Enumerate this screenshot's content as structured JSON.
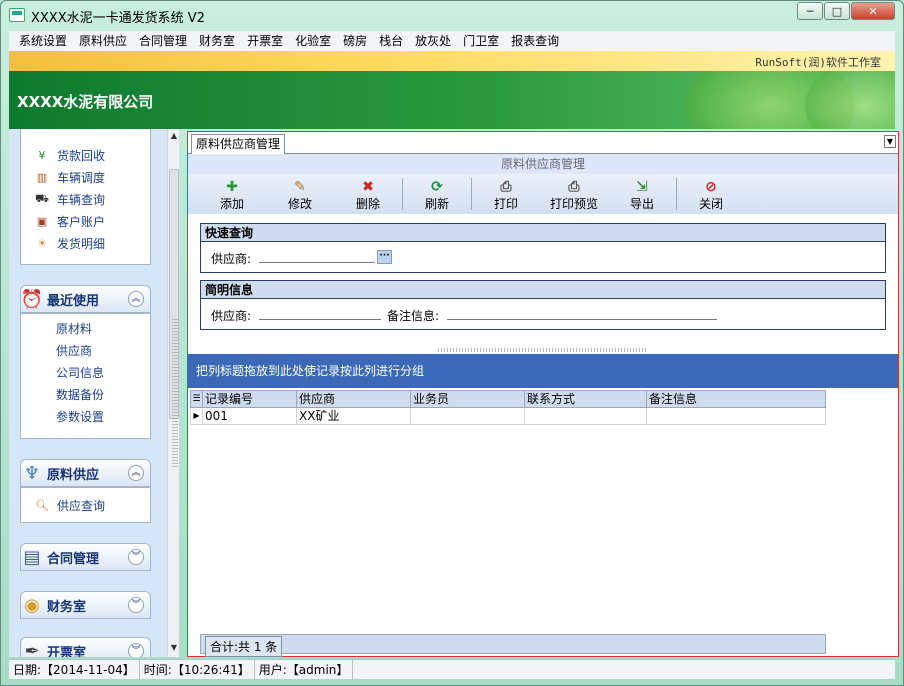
{
  "window": {
    "title": "XXXX水泥一卡通发货系统 V2",
    "min": "─",
    "max": "□",
    "close": "✕"
  },
  "menu": [
    "系统设置",
    "原料供应",
    "合同管理",
    "财务室",
    "开票室",
    "化验室",
    "磅房",
    "栈台",
    "放灰处",
    "门卫室",
    "报表查询"
  ],
  "studio": "RunSoft(润)软件工作室",
  "company": "XXXX水泥有限公司",
  "sidebar": {
    "common_items": [
      {
        "label": "货款回收",
        "icon": "yen-icon",
        "glyph": "¥"
      },
      {
        "label": "车辆调度",
        "icon": "dispatch-icon",
        "glyph": "▥"
      },
      {
        "label": "车辆查询",
        "icon": "truck-icon",
        "glyph": "⛟"
      },
      {
        "label": "客户账户",
        "icon": "account-icon",
        "glyph": "▣"
      },
      {
        "label": "发货明细",
        "icon": "shipment-icon",
        "glyph": "☀"
      }
    ],
    "recent": {
      "title": "最近使用",
      "items": [
        "原材料",
        "供应商",
        "公司信息",
        "数据备份",
        "参数设置"
      ]
    },
    "supply": {
      "title": "原料供应",
      "items": [
        "供应查询"
      ]
    },
    "contract": {
      "title": "合同管理"
    },
    "finance": {
      "title": "财务室"
    },
    "billing": {
      "title": "开票室"
    }
  },
  "tab": {
    "label": "原料供应商管理"
  },
  "module_title": "原料供应商管理",
  "toolbar": [
    {
      "label": "添加",
      "glyph": "✚",
      "color": "#2a9a2a",
      "icon": "add-icon"
    },
    {
      "label": "修改",
      "glyph": "✎",
      "color": "#b07a1a",
      "icon": "edit-icon"
    },
    {
      "label": "删除",
      "glyph": "✖",
      "color": "#d02020",
      "icon": "delete-icon"
    },
    {
      "label": "刷新",
      "glyph": "⟳",
      "color": "#1f8a3a",
      "icon": "refresh-icon"
    },
    {
      "label": "打印",
      "glyph": "⎙",
      "color": "#555555",
      "icon": "print-icon"
    },
    {
      "label": "打印预览",
      "glyph": "⎙",
      "color": "#555555",
      "icon": "print-preview-icon"
    },
    {
      "label": "导出",
      "glyph": "⇲",
      "color": "#3a8a3a",
      "icon": "export-icon"
    },
    {
      "label": "关闭",
      "glyph": "⊘",
      "color": "#d02020",
      "icon": "close-icon"
    }
  ],
  "quick": {
    "title": "快速查询",
    "supplier_label": "供应商:",
    "supplier_value": "",
    "ellipsis": "···"
  },
  "brief": {
    "title": "简明信息",
    "supplier_label": "供应商:",
    "supplier_value": "",
    "remark_label": "备注信息:",
    "remark_value": ""
  },
  "group_hint": "把列标题拖放到此处使记录按此列进行分组",
  "grid": {
    "columns": [
      "记录编号",
      "供应商",
      "业务员",
      "联系方式",
      "备注信息"
    ],
    "rows": [
      [
        "001",
        "XX矿业",
        "",
        "",
        ""
      ]
    ]
  },
  "total": "合计:共 1 条",
  "status": {
    "date": "日期:【2014-11-04】",
    "time": "时间:【10:26:41】",
    "user": "用户:【admin】"
  }
}
